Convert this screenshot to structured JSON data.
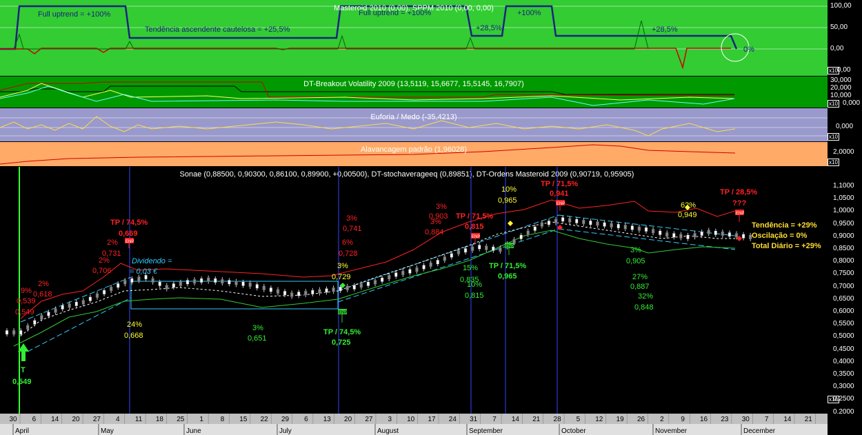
{
  "panels": {
    "masteroid": {
      "title": "Masteroid 2010 (0,00), SPPM 2010 (0,00, 0,00)",
      "scale": [
        "100,00",
        "50,00",
        "0,00",
        "0,00"
      ],
      "x10": "x10",
      "notes": [
        "Full uptrend = +100%",
        "Tendência ascendente cautelosa = +25,5%",
        "Full uptrend = +100%",
        "+28,5%",
        "+100%",
        "+28,5%",
        "0%"
      ]
    },
    "breakout": {
      "title": "DT-Breakout Volatility 2009 (13,5119, 15,6677, 15,5145, 16,7907)",
      "scale": [
        "30,000",
        "20,000",
        "10,000",
        "0,000"
      ],
      "x10": "x10"
    },
    "euforia": {
      "title": "Euforia / Medo (-35,4213)",
      "scale": [
        "0,000"
      ],
      "x10": "x10"
    },
    "alavancagem": {
      "title": "Alavancagem padrão (1,96028)",
      "scale": [
        "2,0000"
      ],
      "x10": "x10"
    },
    "price": {
      "title": "Sonae (0,88500, 0,90300, 0,86100, 0,89900, +0,00500), DT-stochaverageeq (0,89851), DT-Ordens Masteroid 2009 (0,90719, 0,95905)",
      "scale": [
        "1,1000",
        "1,0500",
        "1,0000",
        "0,9500",
        "0,9000",
        "0,8500",
        "0,8000",
        "0,7500",
        "0,7000",
        "0,6500",
        "0,6000",
        "0,5500",
        "0,5000",
        "0,4500",
        "0,4000",
        "0,3500",
        "0,3000",
        "0,2500",
        "0,2000"
      ],
      "x10": "x10"
    }
  },
  "annotations": {
    "red": [
      "TP / 74,5%",
      "0,669",
      "TP / 71,5%",
      "0,815",
      "TP / 71,5%",
      "0,941",
      "TP / 28,5%",
      "???",
      "2%",
      "0,618",
      "2%",
      "0,731",
      "2%",
      "0,706",
      "9%",
      "0,539",
      "0,549",
      "3%",
      "0,741",
      "6%",
      "0,728",
      "3%",
      "0,903",
      "3%",
      "0,884"
    ],
    "green": [
      "TP / 74,5%",
      "0,725",
      "TP / 71,5%",
      "0,965",
      "T",
      "0,549",
      "3%",
      "0,651",
      "15%",
      "0,835",
      "10%",
      "0,815",
      "27%",
      "0,887",
      "32%",
      "0,848",
      "3%",
      "0,905"
    ],
    "yellow": [
      "24%",
      "0,668",
      "3%",
      "0,729",
      "10%",
      "0,965",
      "62%",
      "0,949"
    ],
    "cyan": [
      "Dividendo =",
      "= 0,03 €"
    ],
    "summary": [
      "Tendência = +29%",
      "Oscilação = 0%",
      "Total Diário = +29%"
    ],
    "flag": "ENP"
  },
  "xaxis": {
    "days": [
      "30",
      "6",
      "14",
      "20",
      "27",
      "4",
      "11",
      "18",
      "25",
      "1",
      "8",
      "15",
      "22",
      "29",
      "6",
      "13",
      "20",
      "27",
      "3",
      "10",
      "17",
      "24",
      "31",
      "7",
      "14",
      "21",
      "28",
      "5",
      "12",
      "19",
      "26",
      "2",
      "9",
      "16",
      "23",
      "30",
      "7",
      "14",
      "21"
    ],
    "months": [
      "April",
      "May",
      "June",
      "July",
      "August",
      "September",
      "October",
      "November",
      "December"
    ]
  },
  "chart_data": {
    "type": "line",
    "title": "Sonae (0,88500, 0,90300, 0,86100, 0,89900, +0,00500)",
    "x_months": [
      "April",
      "May",
      "June",
      "July",
      "August",
      "September",
      "October",
      "November",
      "December"
    ],
    "series": [
      {
        "name": "Sonae",
        "approx_close_by_week": [
          0.52,
          0.58,
          0.62,
          0.64,
          0.68,
          0.72,
          0.74,
          0.7,
          0.72,
          0.73,
          0.72,
          0.71,
          0.69,
          0.67,
          0.68,
          0.69,
          0.7,
          0.72,
          0.75,
          0.77,
          0.8,
          0.84,
          0.86,
          0.85,
          0.9,
          0.95,
          0.97,
          0.96,
          0.95,
          0.94,
          0.93,
          0.91,
          0.9,
          0.92,
          0.91,
          0.9
        ]
      }
    ],
    "ylim": [
      0.2,
      1.1
    ]
  },
  "colors": {
    "green_panel": "#33cc33",
    "dark_green": "#009900",
    "lavender": "#9999cc",
    "orange": "#ffaa66",
    "price_bg": "#000000"
  }
}
